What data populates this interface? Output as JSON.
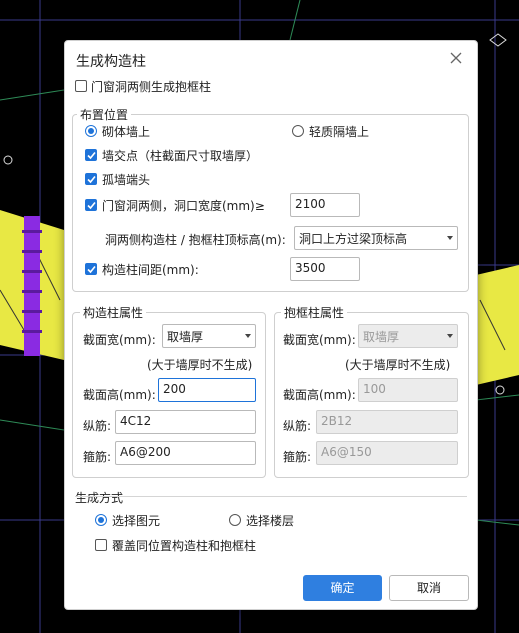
{
  "dialog": {
    "title": "生成构造柱",
    "door_window_frame_label": "门窗洞两侧生成抱框柱",
    "door_window_frame_checked": false
  },
  "layout_group": {
    "legend": "布置位置",
    "radio_masonry": "砌体墙上",
    "radio_light": "轻质隔墙上",
    "wall_intersection": "墙交点（柱截面尺寸取墙厚）",
    "isolated_wall_end": "孤墙端头",
    "opening_sides_label": "门窗洞两侧，洞口宽度(mm)≥",
    "opening_width": "2100",
    "top_elev_label": "洞两侧构造柱 / 抱框柱顶标高(m):",
    "top_elev_value": "洞口上方过梁顶标高",
    "spacing_label": "构造柱间距(mm):",
    "spacing_value": "3500"
  },
  "column_props": {
    "legend": "构造柱属性",
    "width_label": "截面宽(mm):",
    "width_value": "取墙厚",
    "note": "(大于墙厚时不生成)",
    "height_label": "截面高(mm):",
    "height_value": "200",
    "long_bar_label": "纵筋:",
    "long_bar_value": "4C12",
    "stirrup_label": "箍筋:",
    "stirrup_value": "A6@200"
  },
  "frame_props": {
    "legend": "抱框柱属性",
    "width_label": "截面宽(mm):",
    "width_value": "取墙厚",
    "note": "(大于墙厚时不生成)",
    "height_label": "截面高(mm):",
    "height_value": "100",
    "long_bar_label": "纵筋:",
    "long_bar_value": "2B12",
    "stirrup_label": "箍筋:",
    "stirrup_value": "A6@150"
  },
  "gen_mode": {
    "legend": "生成方式",
    "radio_elements": "选择图元",
    "radio_floors": "选择楼层",
    "overwrite_label": "覆盖同位置构造柱和抱框柱"
  },
  "buttons": {
    "ok": "确定",
    "cancel": "取消"
  },
  "colors": {
    "accent": "#2f7fe0",
    "cad_background": "#000000",
    "wall_yellow": "#e8e844",
    "column_purple": "#8a2be2"
  }
}
